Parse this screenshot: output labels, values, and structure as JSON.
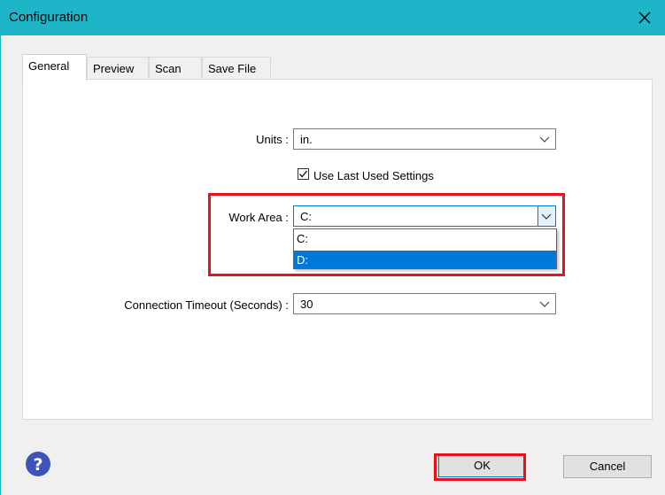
{
  "window": {
    "title": "Configuration",
    "close_glyph": "✕"
  },
  "tabs": [
    {
      "label": "General",
      "active": true
    },
    {
      "label": "Preview",
      "active": false
    },
    {
      "label": "Scan",
      "active": false
    },
    {
      "label": "Save File",
      "active": false
    }
  ],
  "general": {
    "units": {
      "label": "Units :",
      "value": "in."
    },
    "use_last": {
      "label": "Use Last Used Settings",
      "checked": true
    },
    "work_area": {
      "label": "Work Area :",
      "value": "C:",
      "options": [
        "C:",
        "D:"
      ],
      "highlighted_option": "D:"
    },
    "timeout": {
      "label": "Connection Timeout (Seconds) :",
      "value": "30"
    }
  },
  "footer": {
    "help_glyph": "?",
    "ok_label": "OK",
    "cancel_label": "Cancel"
  },
  "colors": {
    "titlebar": "#1fb5c8",
    "accent": "#0078d7",
    "highlight": "#e8101a",
    "help": "#3f54b8"
  }
}
